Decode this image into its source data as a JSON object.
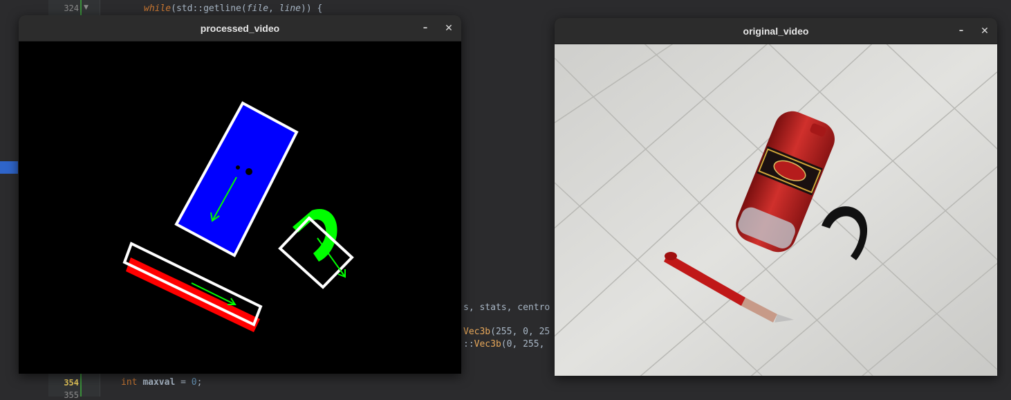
{
  "editor": {
    "line_numbers": [
      {
        "label": "324",
        "current": false
      },
      {
        "label": "354",
        "current": true
      },
      {
        "label": "355",
        "current": false
      }
    ],
    "code_top": {
      "kw": "while",
      "open": "(std::getline(",
      "arg1": "file",
      "sep": ", ",
      "arg2": "line",
      "close": ")) {"
    },
    "code_frag1": "s, stats, centro",
    "code_frag2_cls": "Vec3b",
    "code_frag2_args": "(255, 0, 25",
    "code_frag3_prefix": "::",
    "code_frag3_cls": "Vec3b",
    "code_frag3_args": "(0, 255,",
    "code_bottom": {
      "type": "int",
      "var": "maxval",
      "rest": " = ",
      "num": "0",
      "end": ";"
    },
    "colors": {
      "current_line_number": "#e6c85a",
      "keyword": "#cc7832",
      "gutter_marker": "#3a8f3a",
      "left_indicator": "#2f65ca"
    }
  },
  "windows": {
    "processed": {
      "title": "processed_video",
      "minimize": "–",
      "close": "✕",
      "colors": {
        "blob_blue": "#0000ff",
        "blob_red": "#ff0000",
        "blob_green": "#00ff00",
        "box": "#ffffff",
        "arrow": "#00ff00",
        "background": "#000000"
      }
    },
    "original": {
      "title": "original_video",
      "minimize": "–",
      "close": "✕",
      "objects": [
        "deodorant-stick",
        "black-binder-clip",
        "red-pen"
      ],
      "colors": {
        "cloth": "#d8d8d4",
        "deodorant": "#b3201e",
        "clip": "#111111",
        "pen": "#c01818"
      }
    }
  }
}
